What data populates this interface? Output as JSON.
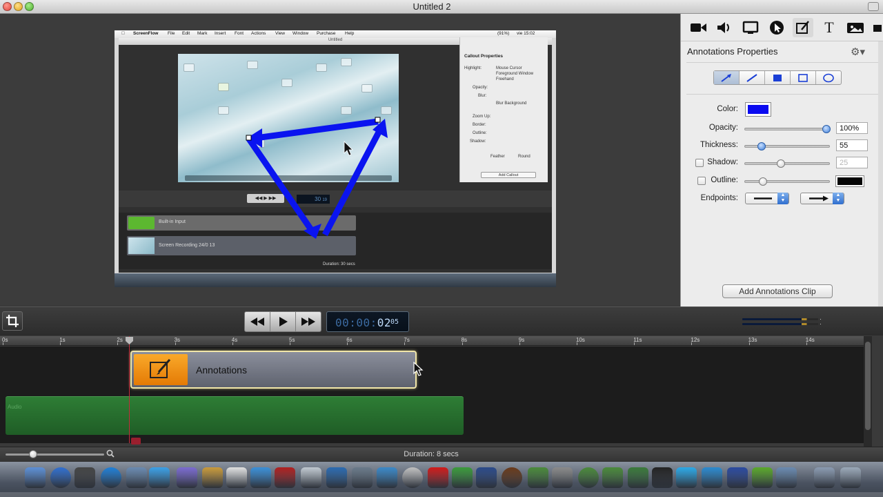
{
  "window": {
    "title": "Untitled 2"
  },
  "preview": {
    "menubar": {
      "app": "ScreenFlow",
      "items": [
        "File",
        "Edit",
        "Mark",
        "Insert",
        "Font",
        "Actions",
        "View",
        "Window",
        "Purchase",
        "Help"
      ],
      "status": "vie 15:02",
      "battery": "(91%)"
    },
    "window_title": "Untitled",
    "callout_title": "Callout Properties",
    "callout_highlight_options": [
      "Mouse Cursor",
      "Foreground Window",
      "Freehand"
    ],
    "callout_labels": [
      "Highlight:",
      "Opacity:",
      "Blur:",
      "Blur Background",
      "Zoom Up:",
      "Border:",
      "Outline:",
      "Shadow:",
      "Feather",
      "Round"
    ],
    "add_callout": "Add Callout",
    "timecode": "30",
    "timecode_frames": "19",
    "track1_label": "Built-in Input",
    "track2_label": "Screen Recording 24/0 13",
    "duration": "Duration: 30 secs",
    "annotation_color": "#0a14f0"
  },
  "panel": {
    "title": "Annotations Properties",
    "color_label": "Color:",
    "color_value": "#0a0af0",
    "opacity_label": "Opacity:",
    "opacity_value": "100%",
    "opacity_level": 1.0,
    "thickness_label": "Thickness:",
    "thickness_value": "55",
    "thickness_level": 0.2,
    "shadow_label": "Shadow:",
    "shadow_value": "25",
    "shadow_checked": false,
    "outline_label": "Outline:",
    "outline_checked": false,
    "outline_color": "#050505",
    "endpoints_label": "Endpoints:",
    "add_button": "Add Annotations Clip",
    "tools": [
      "video-icon",
      "audio-icon",
      "screen-icon",
      "cursor-icon",
      "annotation-icon",
      "text-icon",
      "media-icon"
    ],
    "shapes": [
      "arrow-tool",
      "line-tool",
      "filled-rect-tool",
      "rect-tool",
      "ellipse-tool"
    ]
  },
  "transport": {
    "timecode_dim": "00:00:",
    "timecode_bright": "02",
    "timecode_frames": "05"
  },
  "ruler": {
    "labels": [
      "0s",
      "1s",
      "2s",
      "3s",
      "4s",
      "5s",
      "6s",
      "7s",
      "8s",
      "9s",
      "10s",
      "11s",
      "12s",
      "13s",
      "14s"
    ]
  },
  "timeline": {
    "clip_label": "Annotations",
    "audio_label": "Audio"
  },
  "status": {
    "duration": "Duration: 8 secs"
  }
}
